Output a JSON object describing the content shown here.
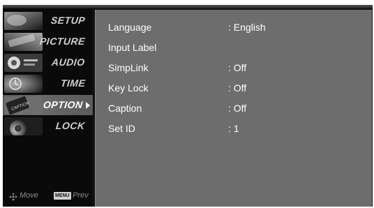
{
  "sidebar": {
    "items": [
      {
        "label": "SETUP",
        "icon": "setup-thumbnail-icon",
        "active": false
      },
      {
        "label": "PICTURE",
        "icon": "picture-thumbnail-icon",
        "active": false
      },
      {
        "label": "AUDIO",
        "icon": "audio-thumbnail-icon",
        "active": false
      },
      {
        "label": "TIME",
        "icon": "time-thumbnail-icon",
        "active": false
      },
      {
        "label": "OPTION",
        "icon": "option-thumbnail-icon",
        "active": true
      },
      {
        "label": "LOCK",
        "icon": "lock-thumbnail-icon",
        "active": false
      }
    ],
    "hints": {
      "move_label": "Move",
      "menu_key": "MENU",
      "prev_label": "Prev"
    }
  },
  "options": {
    "rows": [
      {
        "label": "Language",
        "value": ": English"
      },
      {
        "label": "Input Label",
        "value": ""
      },
      {
        "label": "SimpLink",
        "value": ": Off"
      },
      {
        "label": "Key Lock",
        "value": ": Off"
      },
      {
        "label": "Caption",
        "value": ": Off"
      },
      {
        "label": "Set ID",
        "value": ": 1"
      }
    ]
  },
  "colors": {
    "panel_bg": "#6d6d6d",
    "sidebar_bg": "#0a0a0a",
    "active_item_bg": "#5b5b5b",
    "text": "#ffffff"
  }
}
